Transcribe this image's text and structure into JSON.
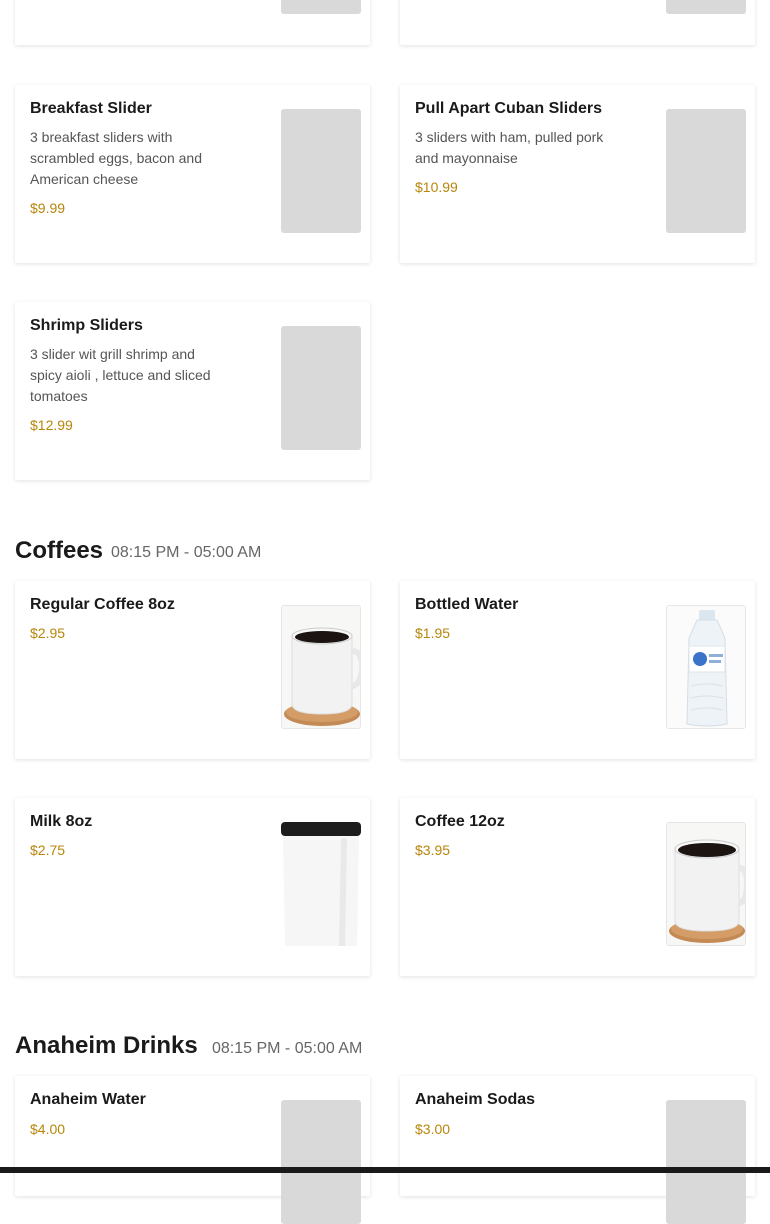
{
  "partial_cards": [
    {
      "name": "",
      "price": ""
    },
    {
      "name": "",
      "price": ""
    }
  ],
  "sliders": [
    {
      "name": "Breakfast Slider",
      "desc": "3 breakfast sliders with scrambled eggs, bacon and American cheese",
      "price": "$9.99",
      "image": "placeholder"
    },
    {
      "name": "Pull Apart Cuban Sliders",
      "desc": "3 sliders with ham, pulled pork and mayonnaise",
      "price": "$10.99",
      "image": "placeholder"
    },
    {
      "name": "Shrimp Sliders",
      "desc": "3 slider wit grill shrimp and spicy aioli , lettuce and sliced tomatoes",
      "price": "$12.99",
      "image": "placeholder"
    }
  ],
  "coffees": {
    "title": "Coffees",
    "hours": "08:15 PM - 05:00 AM",
    "items": [
      {
        "name": "Regular Coffee 8oz",
        "price": "$2.95",
        "image": "coffee-mug-icon"
      },
      {
        "name": "Bottled Water",
        "price": "$1.95",
        "image": "water-bottle-icon"
      },
      {
        "name": "Milk 8oz",
        "price": "$2.75",
        "image": "milk-cup-icon"
      },
      {
        "name": "Coffee 12oz",
        "price": "$3.95",
        "image": "coffee-mug-icon"
      }
    ]
  },
  "anaheim": {
    "title": "Anaheim Drinks",
    "hours": "08:15 PM - 05:00 AM",
    "items": [
      {
        "name": "Anaheim Water",
        "price": "$4.00",
        "image": "placeholder"
      },
      {
        "name": "Anaheim Sodas",
        "price": "$3.00",
        "image": "placeholder"
      }
    ]
  },
  "colors": {
    "price": "#b8860b",
    "placeholder": "#d9d9d9",
    "text": "#1a1a1a"
  }
}
